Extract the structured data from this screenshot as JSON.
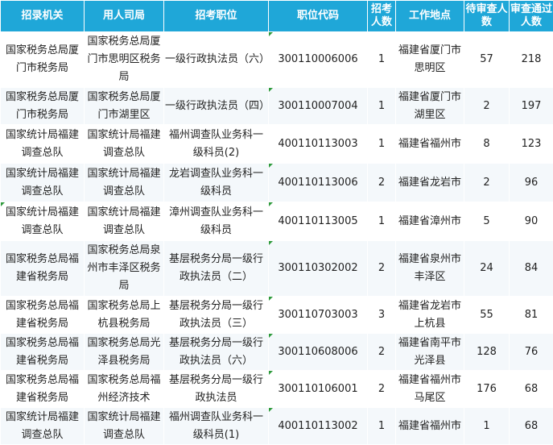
{
  "table": {
    "headers": [
      "招录机关",
      "用人司局",
      "招考职位",
      "职位代码",
      "招考人数",
      "工作地点",
      "待审查人数",
      "审查通过人数"
    ],
    "rows": [
      {
        "agency": "国家税务总局厦门市税务局",
        "bureau": "国家税务总局厦门市思明区税务局",
        "position": "一级行政执法员（六）",
        "code": "300110006006",
        "hires": "1",
        "location": "福建省厦门市思明区",
        "pending": "57",
        "passed": "218"
      },
      {
        "agency": "国家税务总局厦门市税务局",
        "bureau": "国家税务总局厦门市湖里区",
        "position": "一级行政执法员（四）",
        "code": "300110007004",
        "hires": "1",
        "location": "福建省厦门市湖里区",
        "pending": "2",
        "passed": "197"
      },
      {
        "agency": "国家统计局福建调查总队",
        "bureau": "国家统计局福建调查总队",
        "position": "福州调查队业务科一级科员(2)",
        "code": "400110113003",
        "hires": "1",
        "location": "福建省福州市",
        "pending": "8",
        "passed": "123"
      },
      {
        "agency": "国家统计局福建调查总队",
        "bureau": "国家统计局福建调查总队",
        "position": "龙岩调查队业务科一级科员",
        "code": "400110113006",
        "hires": "2",
        "location": "福建省龙岩市",
        "pending": "2",
        "passed": "96"
      },
      {
        "agency": "国家统计局福建调查总队",
        "bureau": "国家统计局福建调查总队",
        "position": "漳州调查队业务科一级科员",
        "code": "400110113005",
        "hires": "1",
        "location": "福建省漳州市",
        "pending": "5",
        "passed": "90"
      },
      {
        "agency": "国家税务总局福建省税务局",
        "bureau": "国家税务总局泉州市丰泽区税务局",
        "position": "基层税务分局一级行政执法员（二）",
        "code": "300110302002",
        "hires": "2",
        "location": "福建省泉州市丰泽区",
        "pending": "24",
        "passed": "84"
      },
      {
        "agency": "国家税务总局福建省税务局",
        "bureau": "国家税务总局上杭县税务局",
        "position": "基层税务分局一级行政执法员（三）",
        "code": "300110703003",
        "hires": "3",
        "location": "福建省龙岩市上杭县",
        "pending": "55",
        "passed": "81"
      },
      {
        "agency": "国家税务总局福建省税务局",
        "bureau": "国家税务总局光泽县税务局",
        "position": "基层税务分局一级行政执法员（六）",
        "code": "300110608006",
        "hires": "2",
        "location": "福建省南平市光泽县",
        "pending": "128",
        "passed": "76"
      },
      {
        "agency": "国家税务总局福建省税务局",
        "bureau": "国家税务总局福州经济技术",
        "position": "基层税务分局一级行政执法员",
        "code": "300110106001",
        "hires": "2",
        "location": "福建省福州市马尾区",
        "pending": "176",
        "passed": "68"
      },
      {
        "agency": "国家统计局福建调查总队",
        "bureau": "国家统计局福建调查总队",
        "position": "福州调查队业务科一级科员(1)",
        "code": "400110113002",
        "hires": "1",
        "location": "福建省福州市",
        "pending": "1",
        "passed": "68"
      }
    ]
  }
}
